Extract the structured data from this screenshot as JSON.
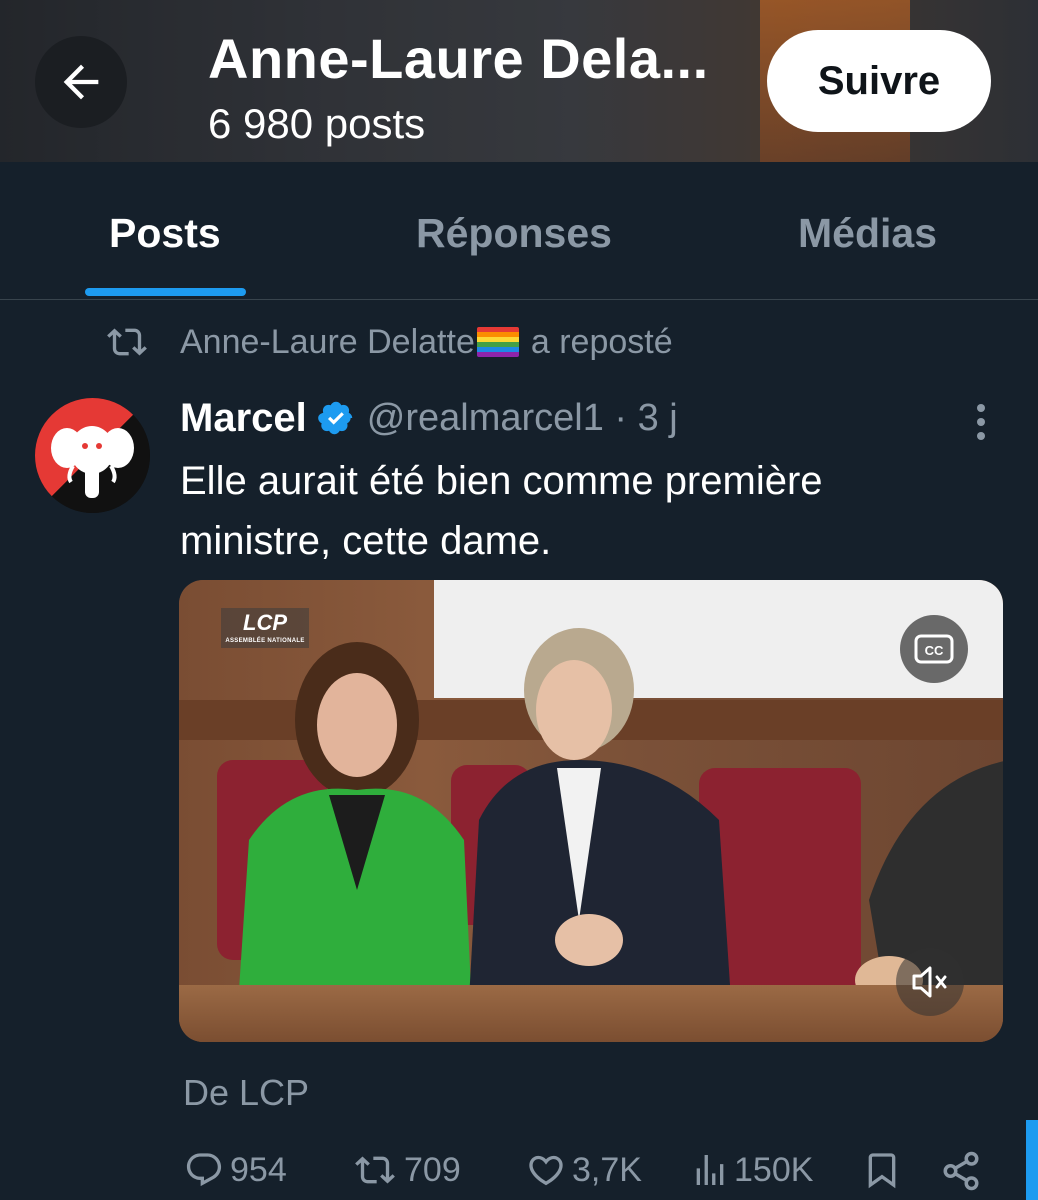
{
  "header": {
    "title": "Anne-Laure Dela...",
    "post_count": "6 980 posts",
    "follow_label": "Suivre"
  },
  "tabs": [
    {
      "label": "Posts",
      "active": true
    },
    {
      "label": "Réponses",
      "active": false
    },
    {
      "label": "Médias",
      "active": false
    }
  ],
  "repost": {
    "reposter": "Anne-Laure Delatte",
    "action": "a reposté"
  },
  "post": {
    "author": "Marcel",
    "verified": true,
    "handle": "@realmarcel1 · 3 j",
    "text": "Elle aurait été bien comme première ministre, cette dame.",
    "media": {
      "logo_text": "LCP",
      "logo_subtext": "ASSEMBLÉE NATIONALE",
      "cc_label": "CC"
    },
    "source": "De LCP",
    "stats": {
      "replies": "954",
      "reposts": "709",
      "likes": "3,7K",
      "views": "150K"
    }
  },
  "colors": {
    "background": "#15202b",
    "accent": "#1d9bf0",
    "muted_text": "#8b98a5",
    "text": "#ffffff"
  },
  "icons": [
    "back-arrow-icon",
    "repost-icon",
    "verified-badge-icon",
    "more-vertical-icon",
    "closed-captions-icon",
    "mute-icon",
    "reply-icon",
    "retweet-icon",
    "like-icon",
    "views-icon",
    "bookmark-icon",
    "share-icon"
  ]
}
